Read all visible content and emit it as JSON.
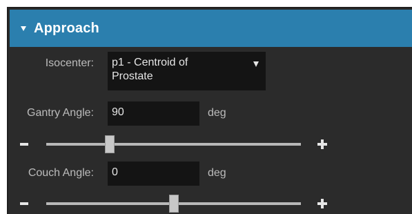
{
  "panel": {
    "title": "Approach",
    "collapse_icon": "triangle-down-icon"
  },
  "isocenter": {
    "label": "Isocenter:",
    "value": "p1 - Centroid of Prostate"
  },
  "gantry": {
    "label": "Gantry Angle:",
    "value": "90",
    "unit": "deg",
    "slider_fraction": 0.25
  },
  "couch": {
    "label": "Couch Angle:",
    "value": "0",
    "unit": "deg",
    "slider_fraction": 0.5
  },
  "controls": {
    "minus_icon": "minus-icon",
    "plus_icon": "plus-icon"
  },
  "colors": {
    "header": "#2b7fae",
    "panel_bg": "#2b2b2b",
    "field_bg": "#141414"
  }
}
